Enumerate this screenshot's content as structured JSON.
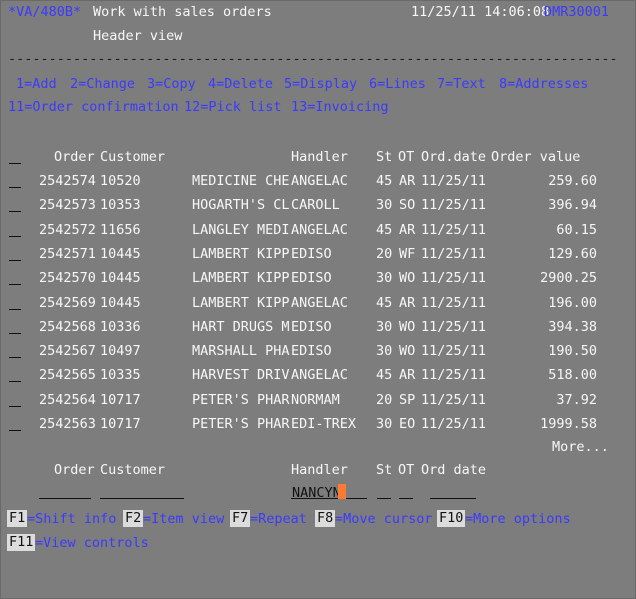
{
  "header": {
    "program": "*VA/480B*",
    "title": "Work with sales orders",
    "datetime": "11/25/11 14:06:08",
    "device": "DMR30001",
    "subtitle": "Header view"
  },
  "options_line1": [
    "1=Add",
    "2=Change",
    "3=Copy",
    "4=Delete",
    "5=Display",
    "6=Lines",
    "7=Text",
    "8=Addresses"
  ],
  "options_line2": [
    "11=Order confirmation",
    "12=Pick list",
    "13=Invoicing"
  ],
  "columns": {
    "order": "Order",
    "customer": "Customer",
    "handler": "Handler",
    "st": "St",
    "ot": "OT",
    "orddate": "Ord.date",
    "value": "Order value"
  },
  "rows": [
    {
      "order": "2542574",
      "cust": "10520",
      "name": "MEDICINE CHE",
      "handler": "ANGELAC",
      "st": "45",
      "ot": "AR",
      "date": "11/25/11",
      "value": "259.60"
    },
    {
      "order": "2542573",
      "cust": "10353",
      "name": "HOGARTH'S CL",
      "handler": "CAROLL",
      "st": "30",
      "ot": "SO",
      "date": "11/25/11",
      "value": "396.94"
    },
    {
      "order": "2542572",
      "cust": "11656",
      "name": "LANGLEY MEDI",
      "handler": "ANGELAC",
      "st": "45",
      "ot": "AR",
      "date": "11/25/11",
      "value": "60.15"
    },
    {
      "order": "2542571",
      "cust": "10445",
      "name": "LAMBERT KIPP",
      "handler": "EDISO",
      "st": "20",
      "ot": "WF",
      "date": "11/25/11",
      "value": "129.60"
    },
    {
      "order": "2542570",
      "cust": "10445",
      "name": "LAMBERT KIPP",
      "handler": "EDISO",
      "st": "30",
      "ot": "WO",
      "date": "11/25/11",
      "value": "2900.25"
    },
    {
      "order": "2542569",
      "cust": "10445",
      "name": "LAMBERT KIPP",
      "handler": "ANGELAC",
      "st": "45",
      "ot": "AR",
      "date": "11/25/11",
      "value": "196.00"
    },
    {
      "order": "2542568",
      "cust": "10336",
      "name": "HART DRUGS M",
      "handler": "EDISO",
      "st": "30",
      "ot": "WO",
      "date": "11/25/11",
      "value": "394.38"
    },
    {
      "order": "2542567",
      "cust": "10497",
      "name": "MARSHALL PHA",
      "handler": "EDISO",
      "st": "30",
      "ot": "WO",
      "date": "11/25/11",
      "value": "190.50"
    },
    {
      "order": "2542565",
      "cust": "10335",
      "name": "HARVEST DRIV",
      "handler": "ANGELAC",
      "st": "45",
      "ot": "AR",
      "date": "11/25/11",
      "value": "518.00"
    },
    {
      "order": "2542564",
      "cust": "10717",
      "name": "PETER'S PHAR",
      "handler": "NORMAM",
      "st": "20",
      "ot": "SP",
      "date": "11/25/11",
      "value": "37.92"
    },
    {
      "order": "2542563",
      "cust": "10717",
      "name": "PETER'S PHAR",
      "handler": "EDI-TREX",
      "st": "30",
      "ot": "EO",
      "date": "11/25/11",
      "value": "1999.58"
    }
  ],
  "more": "More...",
  "filter": {
    "order_label": "Order",
    "customer_label": "Customer",
    "handler_label": "Handler",
    "st_label": "St",
    "ot_label": "OT",
    "date_label": "Ord date",
    "handler_value": "NANCYN"
  },
  "fkeys_line1": [
    {
      "key": "F1",
      "label": "=Shift info"
    },
    {
      "key": "F2",
      "label": "=Item view"
    },
    {
      "key": "F7",
      "label": "=Repeat"
    },
    {
      "key": "F8",
      "label": "=Move cursor"
    },
    {
      "key": "F10",
      "label": "=More options"
    }
  ],
  "fkeys_line2": [
    {
      "key": "F11",
      "label": "=View controls"
    }
  ],
  "colors": {
    "background": "#7d7d7d",
    "text": "#f3f3f3",
    "accent": "#3a3aff",
    "cursor": "#ff7a30"
  }
}
